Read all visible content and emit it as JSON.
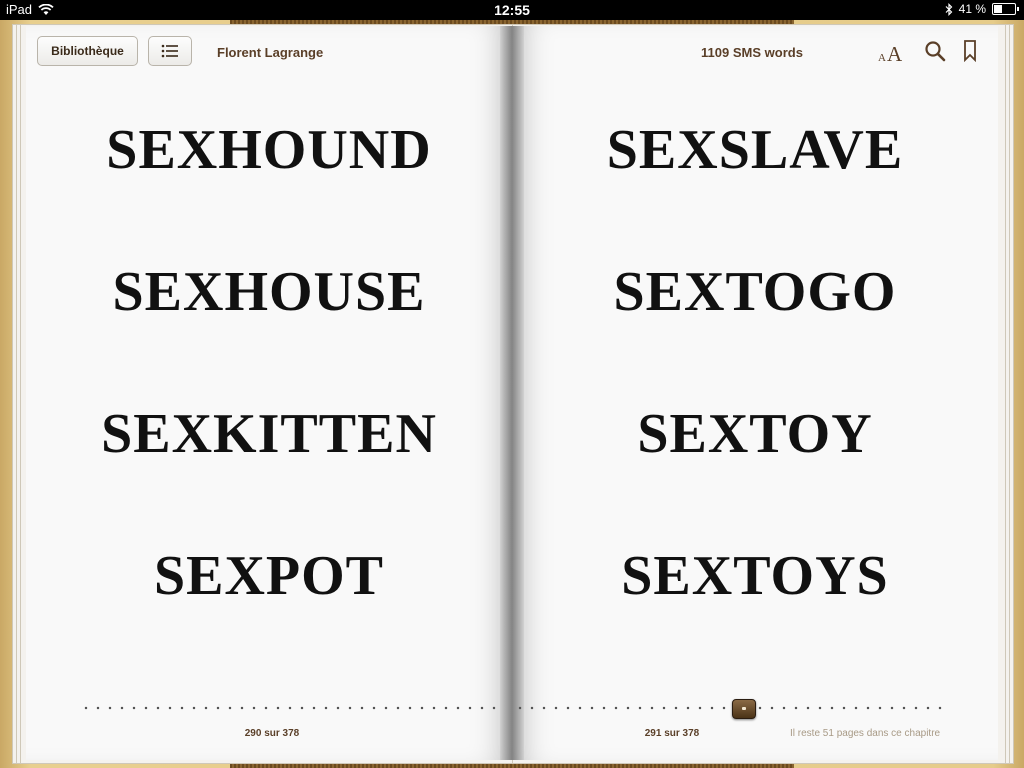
{
  "status_bar": {
    "device": "iPad",
    "time": "12:55",
    "battery": "41 %",
    "battery_level": 0.41
  },
  "toolbar": {
    "library_label": "Bibliothèque",
    "author": "Florent Lagrange",
    "book_title": "1109 SMS words",
    "font_icon_text": "AA"
  },
  "left_page": {
    "words": [
      "SEXHOUND",
      "SEXHOUSE",
      "SEXKITTEN",
      "SEXPOT"
    ],
    "page_label": "290 sur 378"
  },
  "right_page": {
    "words": [
      "SEXSLAVE",
      "SEXTOGO",
      "SEXTOY",
      "SEXTOYS"
    ],
    "page_label": "291 sur 378",
    "remaining_label": "Il reste 51 pages dans ce chapitre"
  },
  "progress": {
    "current_page": 291,
    "total_pages": 378
  },
  "colors": {
    "toolbar_text": "#5a3f28",
    "page_background": "#f9f9f9",
    "cover": "#e6cc8a"
  },
  "icons": [
    "wifi-icon",
    "bluetooth-icon",
    "battery-icon",
    "table-of-contents-icon",
    "font-size-icon",
    "search-icon",
    "bookmark-icon"
  ]
}
